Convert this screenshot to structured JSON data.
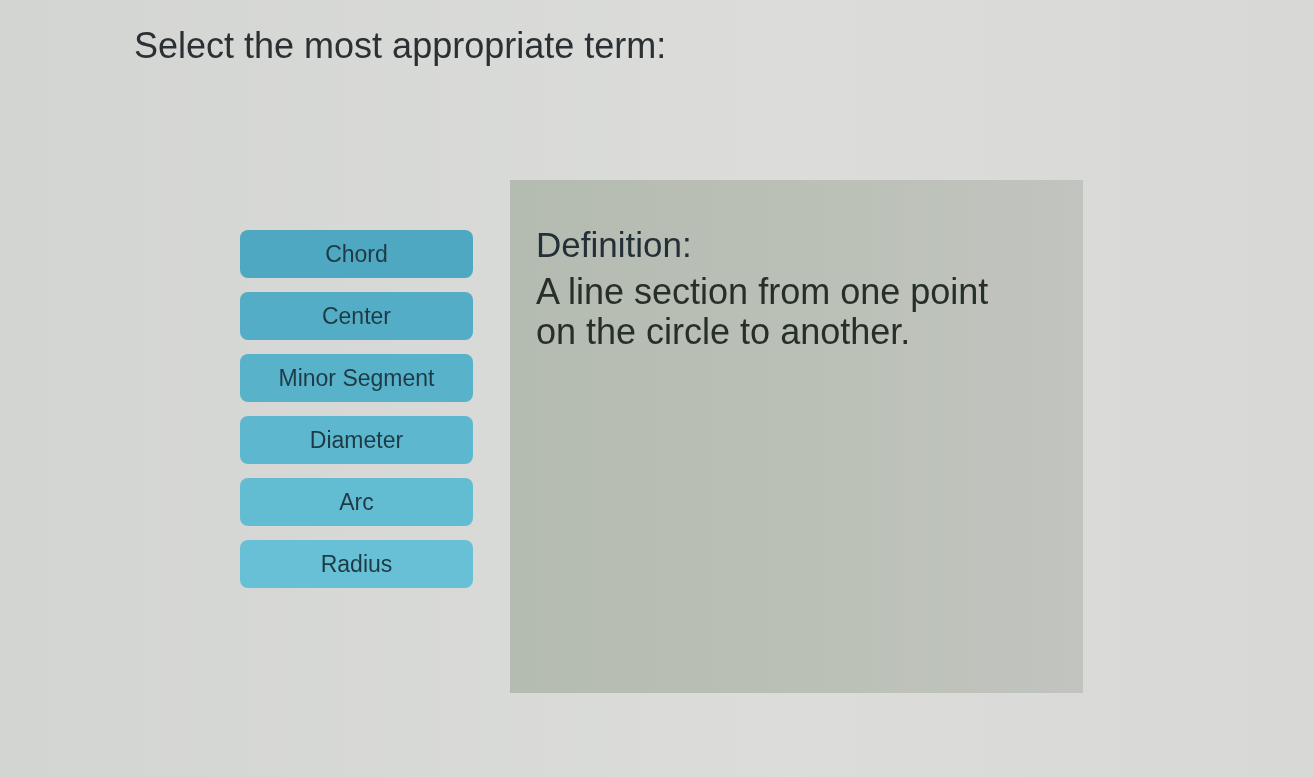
{
  "prompt": "Select the most appropriate term:",
  "terms": [
    {
      "label": "Chord"
    },
    {
      "label": "Center"
    },
    {
      "label": "Minor Segment"
    },
    {
      "label": "Diameter"
    },
    {
      "label": "Arc"
    },
    {
      "label": "Radius"
    }
  ],
  "definition": {
    "heading": "Definition:",
    "text": "A line section from one point on the circle to another."
  }
}
